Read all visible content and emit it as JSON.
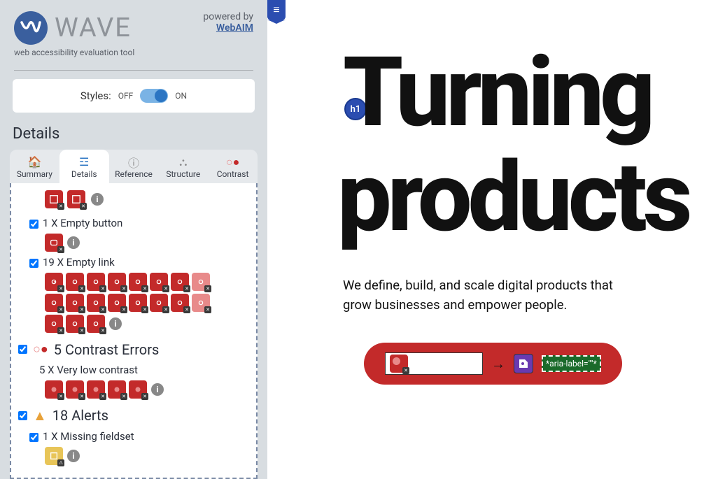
{
  "brand": {
    "name": "WAVE",
    "tagline": "web accessibility evaluation tool"
  },
  "powered": {
    "by": "powered by",
    "link": "WebAIM"
  },
  "styles": {
    "label": "Styles:",
    "off": "OFF",
    "on": "ON"
  },
  "panel": {
    "title": "Details"
  },
  "tabs": {
    "summary": "Summary",
    "details": "Details",
    "reference": "Reference",
    "structure": "Structure",
    "contrast": "Contrast"
  },
  "issues": {
    "empty_button": "1 X Empty button",
    "empty_link": "19 X Empty link",
    "contrast_header": "5 Contrast Errors",
    "very_low": "5 X Very low contrast",
    "alerts_header": "18 Alerts",
    "missing_fieldset": "1 X Missing fieldset"
  },
  "main": {
    "h1_badge": "h1",
    "headline1": "Turning",
    "headline2": "products",
    "subtext1": "We define, build, and scale digital products that",
    "subtext2": "grow businesses and empower people.",
    "arrow": "→",
    "aria_text": "*aria-label=\"\"*",
    "tag_text": "≡"
  }
}
